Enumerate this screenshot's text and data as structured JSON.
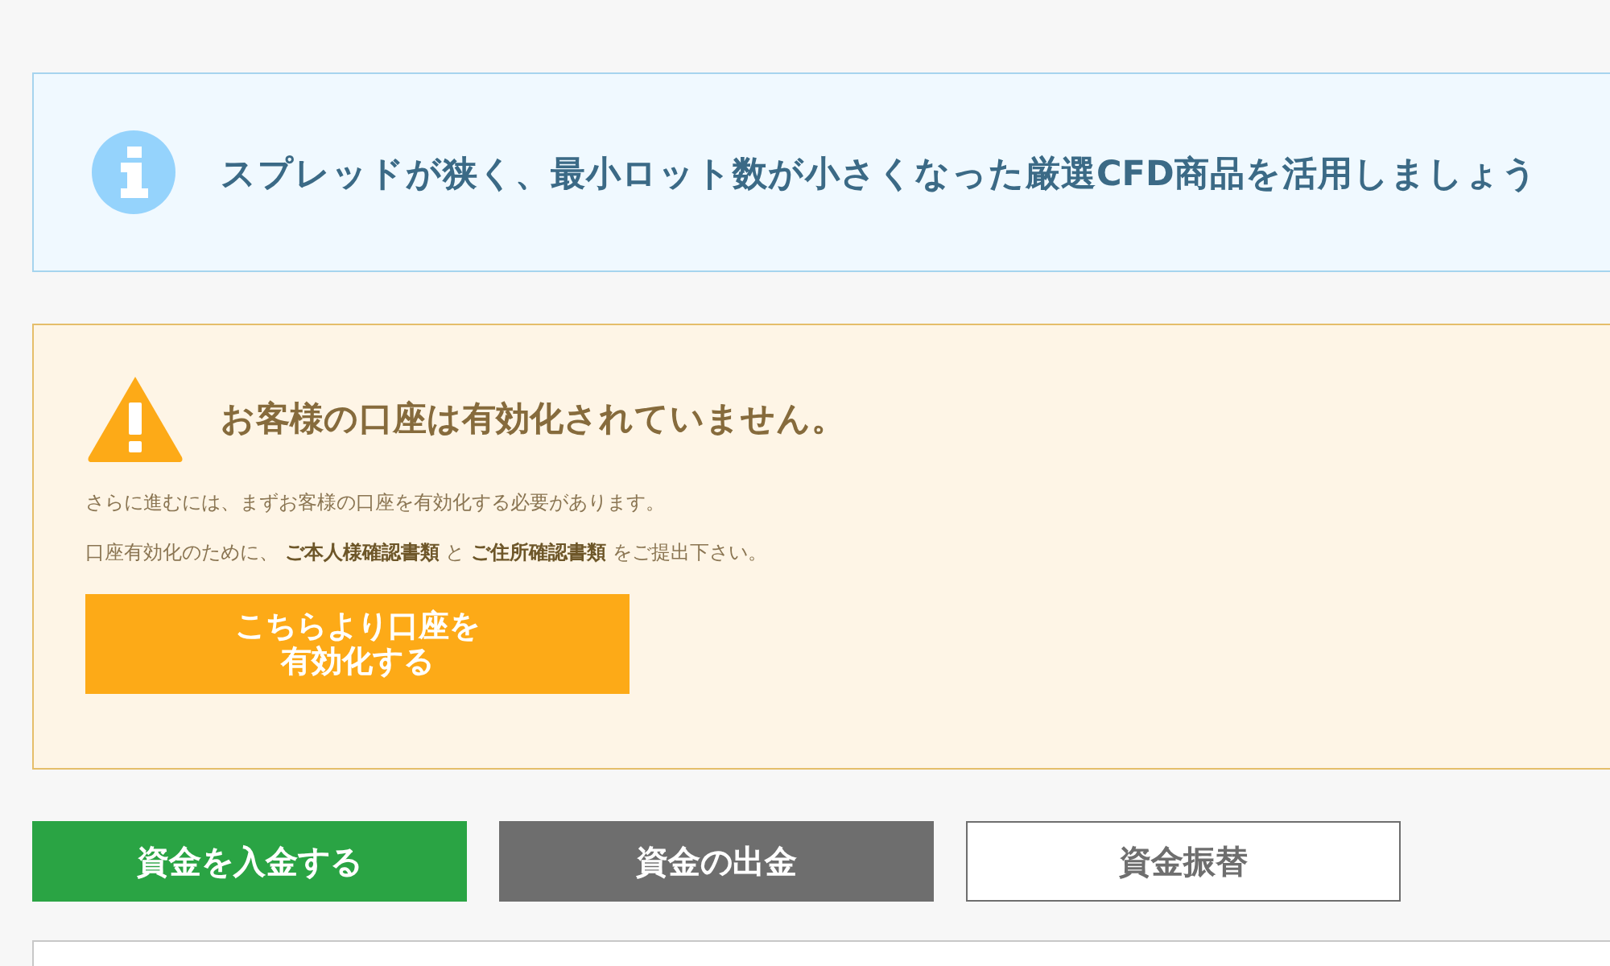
{
  "info_banner": {
    "kind": "info",
    "text": "スプレッドが狭く、最小ロット数が小さくなった厳選CFD商品を活用しましょう"
  },
  "warning_panel": {
    "kind": "warning",
    "title": "お客様の口座は有効化されていません。",
    "lines": [
      "さらに進むには、まずお客様の口座を有効化する必要があります。",
      "口座有効化のために、 **ご本人様確認書類** と **ご住所確認書類** をご提出下さい。"
    ],
    "button": "こちらより口座を有効化する"
  },
  "fund_buttons": [
    {
      "label": "資金を入金する",
      "kind": "primary"
    },
    {
      "label": "資金の出金",
      "kind": "secondary"
    },
    {
      "label": "資金振替",
      "kind": "outline"
    }
  ]
}
